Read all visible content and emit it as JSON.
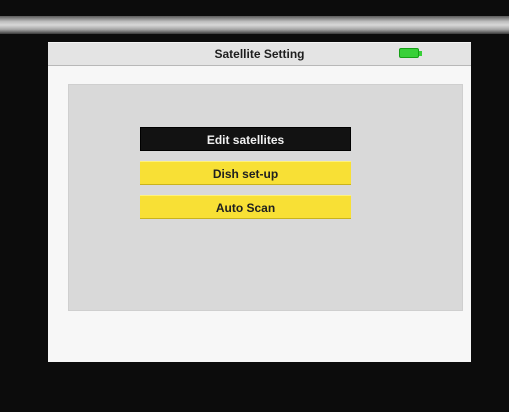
{
  "header": {
    "title": "Satellite Setting",
    "battery_icon": "battery-icon",
    "battery_color": "#38d038"
  },
  "menu": {
    "items": [
      {
        "label": "Edit satellites",
        "selected": true
      },
      {
        "label": "Dish set-up",
        "selected": false
      },
      {
        "label": "Auto Scan",
        "selected": false
      }
    ],
    "selected_bg": "#121212",
    "item_bg": "#f8e035"
  }
}
